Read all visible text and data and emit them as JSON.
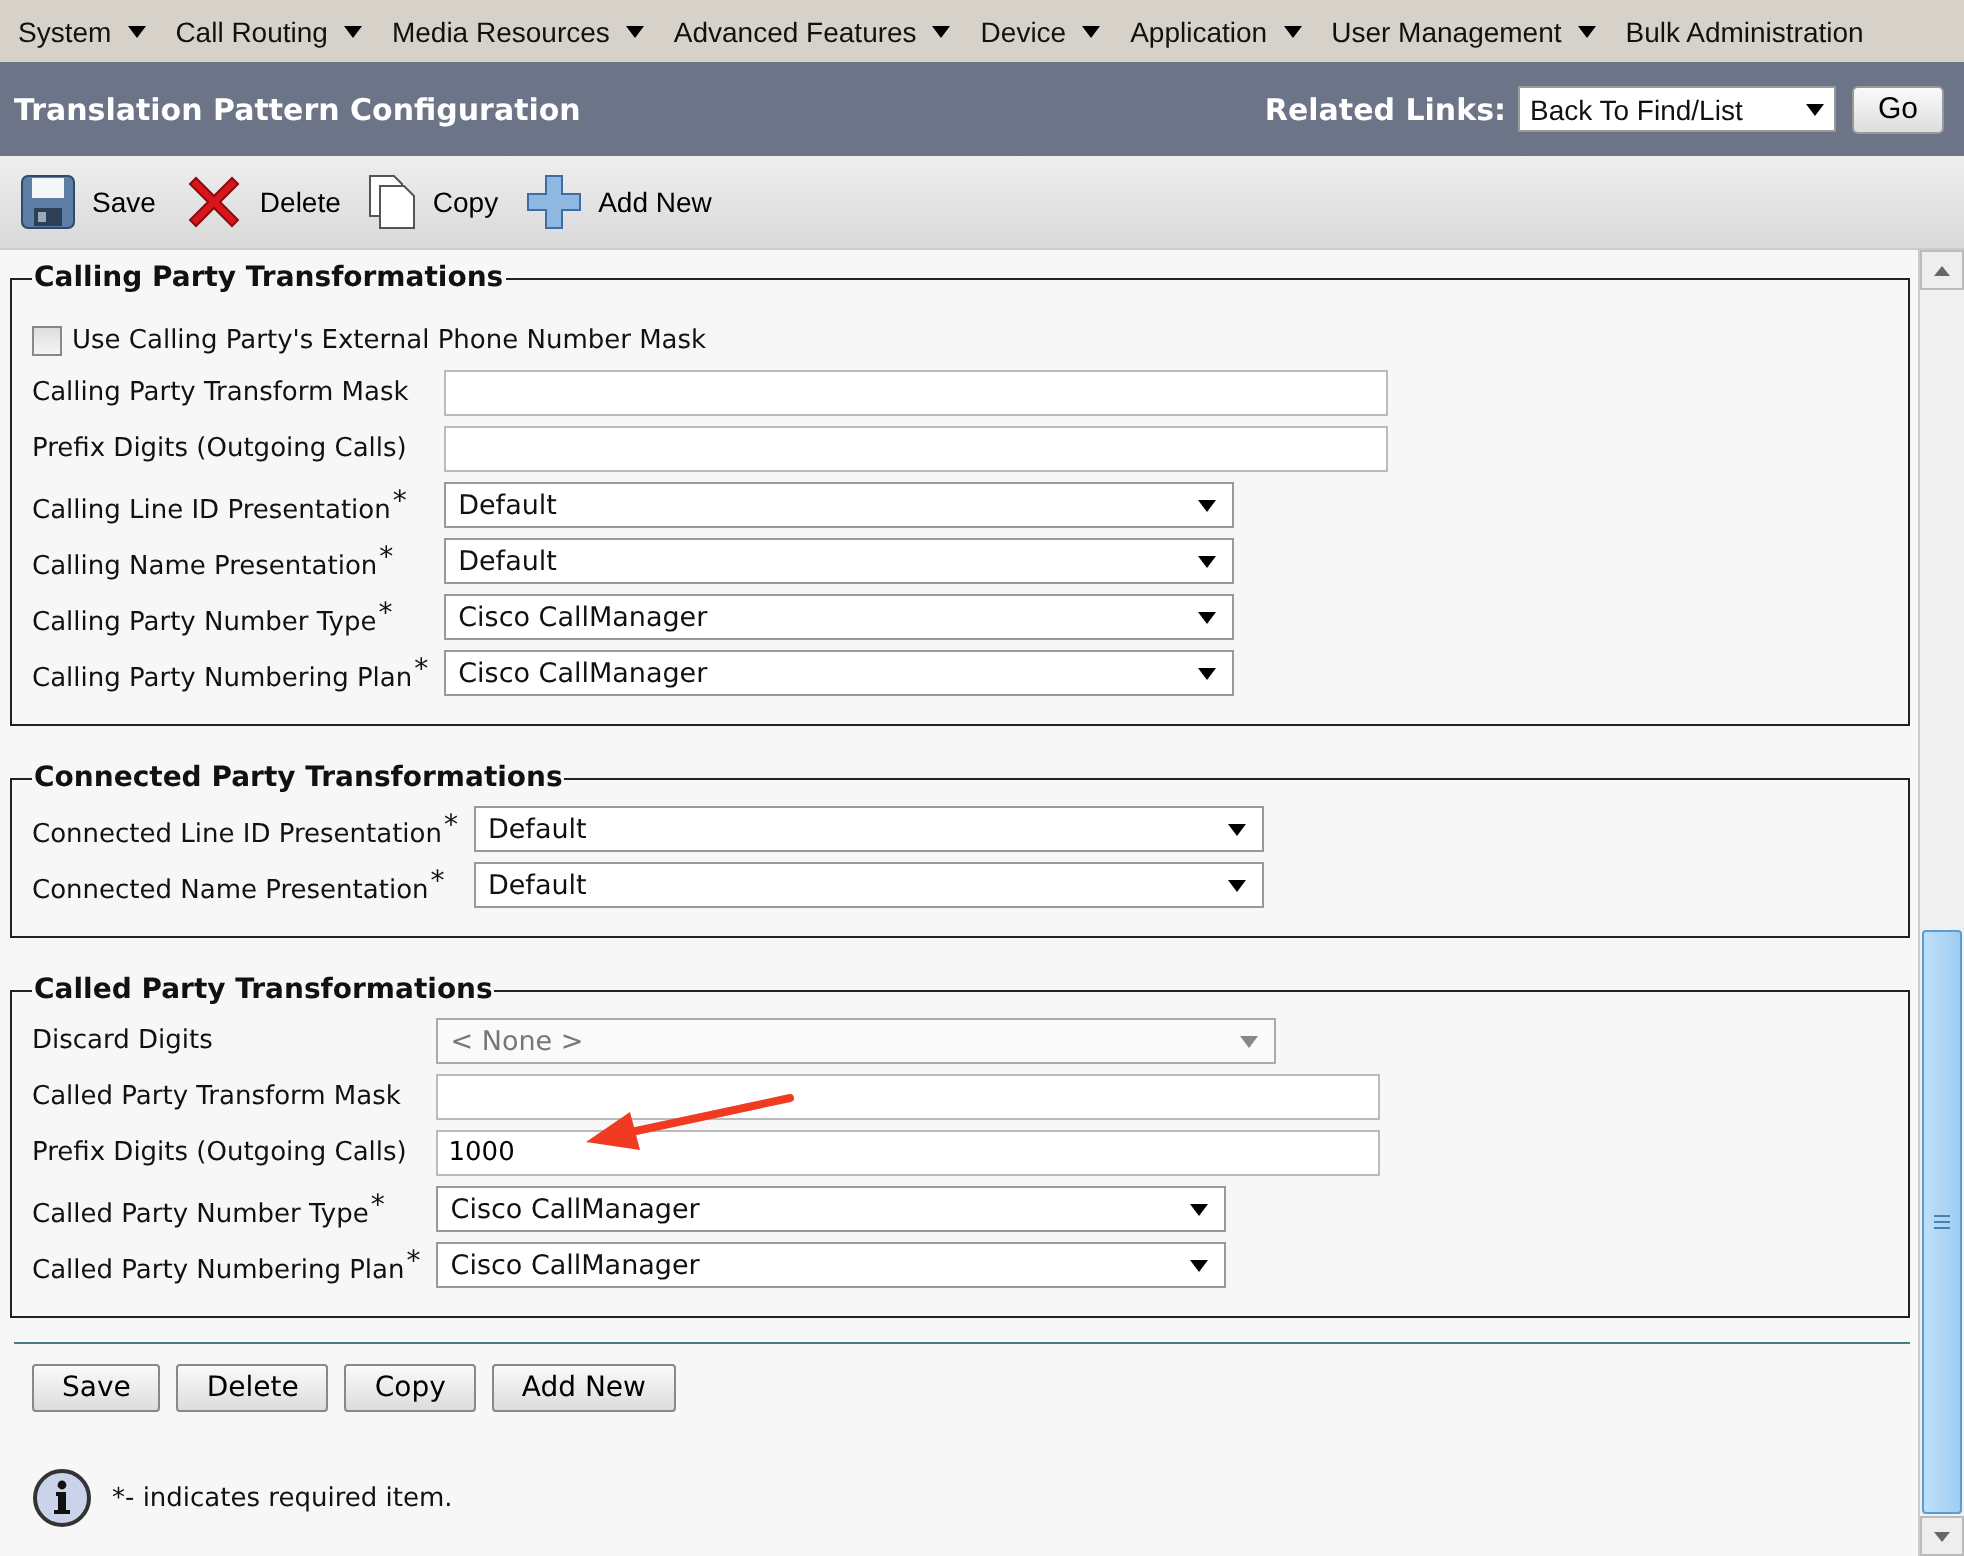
{
  "menu": [
    {
      "label": "System"
    },
    {
      "label": "Call Routing"
    },
    {
      "label": "Media Resources"
    },
    {
      "label": "Advanced Features"
    },
    {
      "label": "Device"
    },
    {
      "label": "Application"
    },
    {
      "label": "User Management"
    },
    {
      "label": "Bulk Administration"
    }
  ],
  "header": {
    "title": "Translation Pattern Configuration",
    "related_label": "Related Links:",
    "related_value": "Back To Find/List",
    "go": "Go"
  },
  "toolbar": [
    {
      "kind": "save",
      "label": "Save"
    },
    {
      "kind": "delete",
      "label": "Delete"
    },
    {
      "kind": "copy",
      "label": "Copy"
    },
    {
      "kind": "add",
      "label": "Add New"
    }
  ],
  "sections": [
    {
      "title": "Calling Party Transformations",
      "fields": [
        {
          "kind": "checkbox",
          "label": "Use Calling Party's External Phone Number Mask",
          "checked": false
        },
        {
          "kind": "text",
          "label": "Calling Party Transform Mask"
        },
        {
          "kind": "text",
          "label": "Prefix Digits (Outgoing Calls)"
        },
        {
          "kind": "select",
          "label": "Calling Line ID Presentation",
          "mark": "*",
          "value": "Default",
          "disabled": false
        },
        {
          "kind": "select",
          "label": "Calling Name Presentation",
          "mark": "*",
          "value": "Default",
          "disabled": false
        },
        {
          "kind": "select",
          "label": "Calling Party Number Type",
          "mark": "*",
          "value": "Cisco CallManager",
          "disabled": false
        },
        {
          "kind": "select",
          "label": "Calling Party Numbering Plan",
          "mark": "*",
          "value": "Cisco CallManager",
          "disabled": false
        }
      ]
    },
    {
      "title": "Connected Party Transformations",
      "fields": [
        {
          "kind": "select",
          "label": "Connected Line ID Presentation",
          "mark": "*",
          "value": "Default",
          "disabled": false
        },
        {
          "kind": "select",
          "label": "Connected Name Presentation",
          "mark": "*",
          "value": "Default",
          "disabled": false
        }
      ]
    },
    {
      "title": "Called Party Transformations",
      "fields": [
        {
          "kind": "select",
          "label": "Discard Digits",
          "value": "< None >",
          "disabled": true
        },
        {
          "kind": "text",
          "label": "Called Party Transform Mask"
        },
        {
          "kind": "text",
          "label": "Prefix Digits (Outgoing Calls)",
          "value": "1000",
          "annotated": true
        },
        {
          "kind": "select",
          "label": "Called Party Number Type",
          "mark": "*",
          "value": "Cisco CallManager",
          "disabled": false
        },
        {
          "kind": "select",
          "label": "Called Party Numbering Plan",
          "mark": "*",
          "value": "Cisco CallManager",
          "disabled": false
        }
      ]
    }
  ],
  "buttons": [
    "Save",
    "Delete",
    "Copy",
    "Add New"
  ],
  "note": "*- indicates required item."
}
